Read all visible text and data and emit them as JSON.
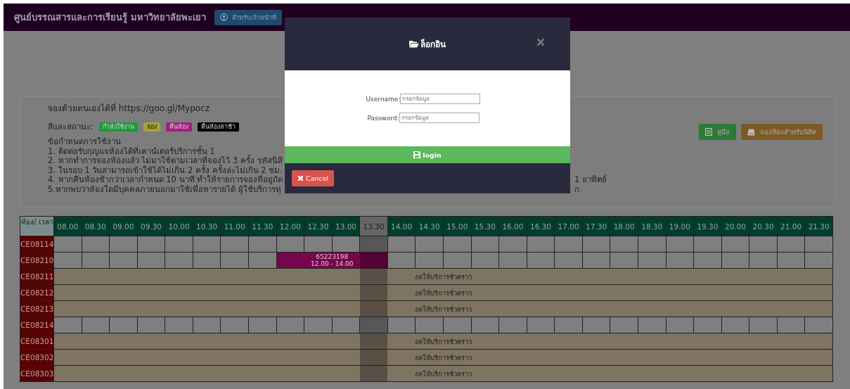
{
  "header": {
    "title": "ศูนย์บรรณสารและการเรียนรู้ มหาวิทยาลัยพะเยา",
    "staff_button": "สำหรับเจ้าหน้าที่"
  },
  "notice": {
    "self_booking": "จองด้วยตนเองได้ที่ https://goo.gl/Mypocz",
    "legend_label": "สีและสถานะ:",
    "legend": [
      {
        "label": "กำลังใช้งาน",
        "color": "#1e9a3c"
      },
      {
        "label": "จอง",
        "color": "#a8a03a"
      },
      {
        "label": "คืนห้อง",
        "color": "#a0207f"
      },
      {
        "label": "คืนห้องล่าช้า",
        "color": "#000000"
      }
    ],
    "rules_title": "ข้อกำหนดการใช้งาน",
    "rules": [
      {
        "text": "1. ติดต่อรับกุญแจห้องได้ที่เคาน์เตอร์บริการชั้น 1"
      },
      {
        "text": "2. หากทำการจองห้องแล้ว ไม่มาใช้ตามเวลาที่จองไว้ 3 ครั้ง รหัสนิสิ"
      },
      {
        "text": "3. ในรอบ 1 วันสามารถเข้าใช้ได้ไม่เกิน 2 ครั้ง ครั้งล่ะไม่เกิน 2 ชม."
      },
      {
        "text": "4. หากคืนห้องช้ากว่าเวลากำหนด 10 นาที ทำให้รายการจองที่อยู่ถัด",
        "tail": "1 อาทิตย์"
      },
      {
        "text": "5.หากพบว่าห้องใดมีบุคคลภายนอกมาใช้เพื่อหารายได้ ผู้ใช้บริการทุ",
        "tail": "ก"
      }
    ],
    "buttons": [
      {
        "label": "คู่มือ",
        "kind": "manual"
      },
      {
        "label": "จองห้องสำหรับนิสิต",
        "kind": "student"
      }
    ]
  },
  "schedule": {
    "corner_label": "ห้อง/ เวลา",
    "times": [
      {
        "label": "08.00",
        "current": false
      },
      {
        "label": "08.30",
        "current": false
      },
      {
        "label": "09.00",
        "current": false
      },
      {
        "label": "09.30",
        "current": false
      },
      {
        "label": "10.00",
        "current": false
      },
      {
        "label": "10.30",
        "current": false
      },
      {
        "label": "11.00",
        "current": false
      },
      {
        "label": "11.30",
        "current": false
      },
      {
        "label": "12.00",
        "current": false
      },
      {
        "label": "12.30",
        "current": false
      },
      {
        "label": "13.00",
        "current": false
      },
      {
        "label": "13.30",
        "current": true
      },
      {
        "label": "14.00",
        "current": false
      },
      {
        "label": "14.30",
        "current": false
      },
      {
        "label": "15.00",
        "current": false
      },
      {
        "label": "15.30",
        "current": false
      },
      {
        "label": "16.00",
        "current": false
      },
      {
        "label": "16.30",
        "current": false
      },
      {
        "label": "17.00",
        "current": false
      },
      {
        "label": "17.30",
        "current": false
      },
      {
        "label": "18.00",
        "current": false
      },
      {
        "label": "18.30",
        "current": false
      },
      {
        "label": "19.00",
        "current": false
      },
      {
        "label": "19.30",
        "current": false
      },
      {
        "label": "20.00",
        "current": false
      },
      {
        "label": "20.30",
        "current": false
      },
      {
        "label": "21.00",
        "current": false
      },
      {
        "label": "21.30",
        "current": false
      }
    ],
    "rooms": [
      {
        "name": "CE08114",
        "kind": "open",
        "slots": [
          {
            "booked": false
          },
          {
            "booked": false
          },
          {
            "booked": false
          },
          {
            "booked": false
          },
          {
            "booked": false
          },
          {
            "booked": false
          },
          {
            "booked": false
          },
          {
            "booked": false
          },
          {
            "booked": false
          },
          {
            "booked": false
          },
          {
            "booked": false
          },
          {
            "booked": false
          },
          {
            "booked": false
          },
          {
            "booked": false
          },
          {
            "booked": false
          },
          {
            "booked": false
          },
          {
            "booked": false
          },
          {
            "booked": false
          },
          {
            "booked": false
          },
          {
            "booked": false
          },
          {
            "booked": false
          },
          {
            "booked": false
          },
          {
            "booked": false
          },
          {
            "booked": false
          },
          {
            "booked": false
          },
          {
            "booked": false
          },
          {
            "booked": false
          },
          {
            "booked": false
          }
        ]
      },
      {
        "name": "CE08210",
        "kind": "open",
        "booking": {
          "code": "65223198",
          "time": "12.00 - 14.00"
        },
        "slots": [
          {
            "booked": false
          },
          {
            "booked": false
          },
          {
            "booked": false
          },
          {
            "booked": false
          },
          {
            "booked": false
          },
          {
            "booked": false
          },
          {
            "booked": false
          },
          {
            "booked": false
          },
          {
            "booked": true
          },
          {
            "booked": true
          },
          {
            "booked": true
          },
          {
            "booked": true
          },
          {
            "booked": false
          },
          {
            "booked": false
          },
          {
            "booked": false
          },
          {
            "booked": false
          },
          {
            "booked": false
          },
          {
            "booked": false
          },
          {
            "booked": false
          },
          {
            "booked": false
          },
          {
            "booked": false
          },
          {
            "booked": false
          },
          {
            "booked": false
          },
          {
            "booked": false
          },
          {
            "booked": false
          },
          {
            "booked": false
          },
          {
            "booked": false
          },
          {
            "booked": false
          }
        ]
      },
      {
        "name": "CE08211",
        "kind": "closed",
        "note": "งดให้บริการชั่วคราว"
      },
      {
        "name": "CE08212",
        "kind": "closed",
        "note": "งดให้บริการชั่วคราว"
      },
      {
        "name": "CE08213",
        "kind": "closed",
        "note": "งดให้บริการชั่วคราว"
      },
      {
        "name": "CE08214",
        "kind": "open",
        "slots": [
          {
            "booked": false
          },
          {
            "booked": false
          },
          {
            "booked": false
          },
          {
            "booked": false
          },
          {
            "booked": false
          },
          {
            "booked": false
          },
          {
            "booked": false
          },
          {
            "booked": false
          },
          {
            "booked": false
          },
          {
            "booked": false
          },
          {
            "booked": false
          },
          {
            "booked": false
          },
          {
            "booked": false
          },
          {
            "booked": false
          },
          {
            "booked": false
          },
          {
            "booked": false
          },
          {
            "booked": false
          },
          {
            "booked": false
          },
          {
            "booked": false
          },
          {
            "booked": false
          },
          {
            "booked": false
          },
          {
            "booked": false
          },
          {
            "booked": false
          },
          {
            "booked": false
          },
          {
            "booked": false
          },
          {
            "booked": false
          },
          {
            "booked": false
          },
          {
            "booked": false
          }
        ]
      },
      {
        "name": "CE08301",
        "kind": "closed",
        "note": "งดให้บริการชั่วคราว"
      },
      {
        "name": "CE08302",
        "kind": "closed",
        "note": "งดให้บริการชั่วคราว"
      },
      {
        "name": "CE08303",
        "kind": "closed",
        "note": "งดให้บริการชั่วคราว"
      }
    ]
  },
  "modal": {
    "title": "ล็อกอิน",
    "fields": [
      {
        "label": "Username:",
        "placeholder": "กรอกข้อมูล"
      },
      {
        "label": "Password:",
        "placeholder": "กรอกข้อมูล"
      }
    ],
    "submit": "login",
    "cancel": "Cancel"
  }
}
